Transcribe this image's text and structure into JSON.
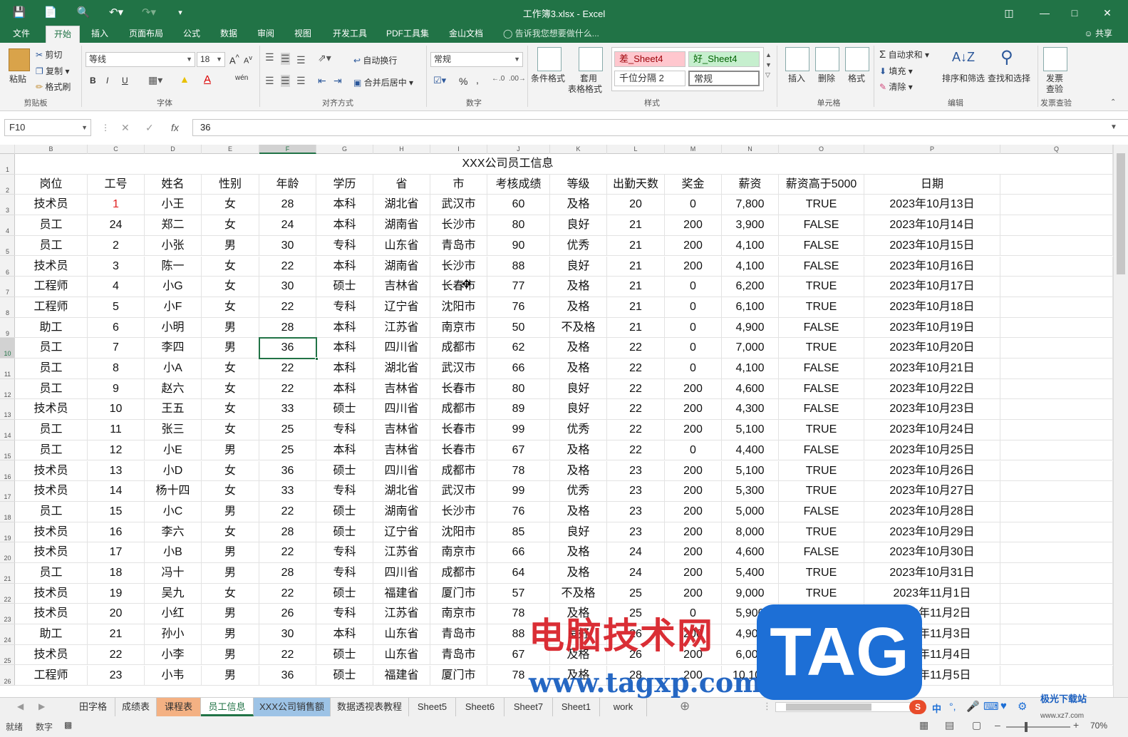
{
  "window": {
    "title": "工作簿3.xlsx - Excel"
  },
  "menu": {
    "tabs": [
      "文件",
      "开始",
      "插入",
      "页面布局",
      "公式",
      "数据",
      "审阅",
      "视图",
      "开发工具",
      "PDF工具集",
      "金山文档"
    ],
    "active": "开始",
    "tell_me": "告诉我您想要做什么...",
    "share": "共享"
  },
  "ribbon": {
    "clipboard": {
      "paste": "粘贴",
      "cut": "剪切",
      "copy": "复制",
      "format_painter": "格式刷",
      "label": "剪贴板"
    },
    "font": {
      "name": "等线",
      "size": "18",
      "bold": "B",
      "italic": "I",
      "underline": "U",
      "wen": "wén",
      "label": "字体"
    },
    "align": {
      "wrap": "自动换行",
      "merge": "合并后居中",
      "label": "对齐方式"
    },
    "number": {
      "format": "常规",
      "percent": "%",
      "comma": ",",
      "label": "数字"
    },
    "styles": {
      "cond": "条件格式",
      "table1": "套用",
      "table2": "表格格式",
      "bad": "差_Sheet4",
      "good": "好_Sheet4",
      "thousands": "千位分隔 2",
      "normal": "常规",
      "label": "样式"
    },
    "cells": {
      "insert": "插入",
      "delete": "删除",
      "format": "格式",
      "label": "单元格"
    },
    "editing": {
      "autosum": "自动求和",
      "fill": "填充",
      "clear": "清除",
      "sort": "排序和筛选",
      "find": "查找和选择",
      "label": "编辑"
    },
    "invoice": {
      "btn1": "发票",
      "btn2": "查验",
      "label": "发票查验"
    }
  },
  "formula_bar": {
    "name_box": "F10",
    "value": "36",
    "fx": "fx"
  },
  "columns": [
    "B",
    "C",
    "D",
    "E",
    "F",
    "G",
    "H",
    "I",
    "J",
    "K",
    "L",
    "M",
    "N",
    "O",
    "P",
    "Q"
  ],
  "selected_column": "F",
  "rows": [
    "1",
    "2",
    "3",
    "4",
    "5",
    "6",
    "7",
    "8",
    "9",
    "10",
    "11",
    "12",
    "13",
    "14",
    "15",
    "16",
    "17",
    "18",
    "19",
    "20",
    "21",
    "22",
    "23",
    "24",
    "25",
    "26"
  ],
  "selected_row": "10",
  "table_title": "XXX公司员工信息",
  "headers": [
    "岗位",
    "工号",
    "姓名",
    "性别",
    "年龄",
    "学历",
    "省",
    "市",
    "考核成绩",
    "等级",
    "出勤天数",
    "奖金",
    "薪资",
    "薪资高于5000",
    "日期"
  ],
  "data": [
    [
      "技术员",
      "1",
      "小王",
      "女",
      "28",
      "本科",
      "湖北省",
      "武汉市",
      "60",
      "及格",
      "20",
      "0",
      "7,800",
      "TRUE",
      "2023年10月13日"
    ],
    [
      "员工",
      "24",
      "郑二",
      "女",
      "24",
      "本科",
      "湖南省",
      "长沙市",
      "80",
      "良好",
      "21",
      "200",
      "3,900",
      "FALSE",
      "2023年10月14日"
    ],
    [
      "员工",
      "2",
      "小张",
      "男",
      "30",
      "专科",
      "山东省",
      "青岛市",
      "90",
      "优秀",
      "21",
      "200",
      "4,100",
      "FALSE",
      "2023年10月15日"
    ],
    [
      "技术员",
      "3",
      "陈一",
      "女",
      "22",
      "本科",
      "湖南省",
      "长沙市",
      "88",
      "良好",
      "21",
      "200",
      "4,100",
      "FALSE",
      "2023年10月16日"
    ],
    [
      "工程师",
      "4",
      "小G",
      "女",
      "30",
      "硕士",
      "吉林省",
      "长春市",
      "77",
      "及格",
      "21",
      "0",
      "6,200",
      "TRUE",
      "2023年10月17日"
    ],
    [
      "工程师",
      "5",
      "小F",
      "女",
      "22",
      "专科",
      "辽宁省",
      "沈阳市",
      "76",
      "及格",
      "21",
      "0",
      "6,100",
      "TRUE",
      "2023年10月18日"
    ],
    [
      "助工",
      "6",
      "小明",
      "男",
      "28",
      "本科",
      "江苏省",
      "南京市",
      "50",
      "不及格",
      "21",
      "0",
      "4,900",
      "FALSE",
      "2023年10月19日"
    ],
    [
      "员工",
      "7",
      "李四",
      "男",
      "36",
      "本科",
      "四川省",
      "成都市",
      "62",
      "及格",
      "22",
      "0",
      "7,000",
      "TRUE",
      "2023年10月20日"
    ],
    [
      "员工",
      "8",
      "小A",
      "女",
      "22",
      "本科",
      "湖北省",
      "武汉市",
      "66",
      "及格",
      "22",
      "0",
      "4,100",
      "FALSE",
      "2023年10月21日"
    ],
    [
      "员工",
      "9",
      "赵六",
      "女",
      "22",
      "本科",
      "吉林省",
      "长春市",
      "80",
      "良好",
      "22",
      "200",
      "4,600",
      "FALSE",
      "2023年10月22日"
    ],
    [
      "技术员",
      "10",
      "王五",
      "女",
      "33",
      "硕士",
      "四川省",
      "成都市",
      "89",
      "良好",
      "22",
      "200",
      "4,300",
      "FALSE",
      "2023年10月23日"
    ],
    [
      "员工",
      "11",
      "张三",
      "女",
      "25",
      "专科",
      "吉林省",
      "长春市",
      "99",
      "优秀",
      "22",
      "200",
      "5,100",
      "TRUE",
      "2023年10月24日"
    ],
    [
      "员工",
      "12",
      "小E",
      "男",
      "25",
      "本科",
      "吉林省",
      "长春市",
      "67",
      "及格",
      "22",
      "0",
      "4,400",
      "FALSE",
      "2023年10月25日"
    ],
    [
      "技术员",
      "13",
      "小D",
      "女",
      "36",
      "硕士",
      "四川省",
      "成都市",
      "78",
      "及格",
      "23",
      "200",
      "5,100",
      "TRUE",
      "2023年10月26日"
    ],
    [
      "技术员",
      "14",
      "杨十四",
      "女",
      "33",
      "专科",
      "湖北省",
      "武汉市",
      "99",
      "优秀",
      "23",
      "200",
      "5,300",
      "TRUE",
      "2023年10月27日"
    ],
    [
      "员工",
      "15",
      "小C",
      "男",
      "22",
      "硕士",
      "湖南省",
      "长沙市",
      "76",
      "及格",
      "23",
      "200",
      "5,000",
      "FALSE",
      "2023年10月28日"
    ],
    [
      "技术员",
      "16",
      "李六",
      "女",
      "28",
      "硕士",
      "辽宁省",
      "沈阳市",
      "85",
      "良好",
      "23",
      "200",
      "8,000",
      "TRUE",
      "2023年10月29日"
    ],
    [
      "技术员",
      "17",
      "小B",
      "男",
      "22",
      "专科",
      "江苏省",
      "南京市",
      "66",
      "及格",
      "24",
      "200",
      "4,600",
      "FALSE",
      "2023年10月30日"
    ],
    [
      "员工",
      "18",
      "冯十",
      "男",
      "28",
      "专科",
      "四川省",
      "成都市",
      "64",
      "及格",
      "24",
      "200",
      "5,400",
      "TRUE",
      "2023年10月31日"
    ],
    [
      "技术员",
      "19",
      "吴九",
      "女",
      "22",
      "硕士",
      "福建省",
      "厦门市",
      "57",
      "不及格",
      "25",
      "200",
      "9,000",
      "TRUE",
      "2023年11月1日"
    ],
    [
      "技术员",
      "20",
      "小红",
      "男",
      "26",
      "专科",
      "江苏省",
      "南京市",
      "78",
      "及格",
      "25",
      "0",
      "5,900",
      "TRUE",
      "2023年11月2日"
    ],
    [
      "助工",
      "21",
      "孙小",
      "男",
      "30",
      "本科",
      "山东省",
      "青岛市",
      "88",
      "良好",
      "26",
      "200",
      "4,900",
      "FALSE",
      "2023年11月3日"
    ],
    [
      "技术员",
      "22",
      "小李",
      "男",
      "22",
      "硕士",
      "山东省",
      "青岛市",
      "67",
      "及格",
      "26",
      "200",
      "6,000",
      "TRUE",
      "2023年11月4日"
    ],
    [
      "工程师",
      "23",
      "小韦",
      "男",
      "36",
      "硕士",
      "福建省",
      "厦门市",
      "78",
      "及格",
      "28",
      "200",
      "10,100",
      "TRUE",
      "2023年11月5日"
    ]
  ],
  "sheets": [
    {
      "name": "田字格",
      "style": "normal"
    },
    {
      "name": "成绩表",
      "style": "normal"
    },
    {
      "name": "课程表",
      "style": "orange"
    },
    {
      "name": "员工信息",
      "style": "active"
    },
    {
      "name": "XXX公司销售额",
      "style": "blue"
    },
    {
      "name": "数据透视表教程",
      "style": "normal"
    },
    {
      "name": "Sheet5",
      "style": "normal"
    },
    {
      "name": "Sheet6",
      "style": "normal"
    },
    {
      "name": "Sheet7",
      "style": "normal"
    },
    {
      "name": "Sheet1",
      "style": "normal"
    },
    {
      "name": "work",
      "style": "normal"
    }
  ],
  "status": {
    "ready": "就绪",
    "mode": "数字",
    "zoom": "70%"
  },
  "ime": {
    "lang": "中"
  },
  "watermark": {
    "cn": "电脑技术网",
    "url": "www.tagxp.com",
    "tag": "TAG",
    "jg": "极光下载站",
    "jg_url": "www.xz7.com"
  },
  "colors": {
    "excel_green": "#217346",
    "first_id_red": "#e02020"
  }
}
